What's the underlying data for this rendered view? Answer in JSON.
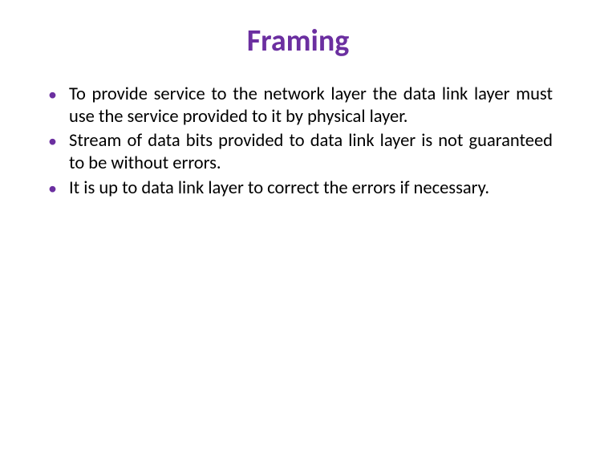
{
  "title_color": "#6b2fa0",
  "bullet_color": "#6b2fa0",
  "title": "Framing",
  "bullets": [
    "To provide service to the network layer the data link layer must use the service provided to it by physical layer.",
    "Stream of data bits provided to data link layer is not guaranteed to be without errors.",
    "It is up to data link layer to correct the errors if necessary."
  ]
}
